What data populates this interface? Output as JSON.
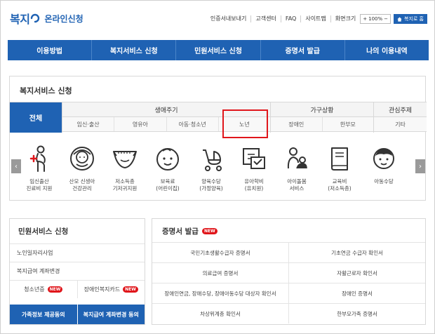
{
  "header": {
    "logo_text": "복지",
    "logo_sub": "온라인신청",
    "util_links": [
      "인증서내보내기",
      "고객센터",
      "FAQ",
      "사이트맵"
    ],
    "zoom_label": "화면크기",
    "zoom_plus": "+",
    "zoom_value": "100%",
    "zoom_minus": "−",
    "home_label": "복지로 홈"
  },
  "gnb": [
    "이용방법",
    "복지서비스 신청",
    "민원서비스 신청",
    "증명서 발급",
    "나의 이용내역"
  ],
  "welfare": {
    "title": "복지서비스 신청",
    "tab_all": "전체",
    "groups": [
      {
        "head": "생애주기",
        "subs": [
          "임신·출산",
          "영유아",
          "아동·청소년",
          "노년"
        ]
      },
      {
        "head": "가구상황",
        "subs": [
          "장애인",
          "한부모"
        ]
      },
      {
        "head": "관심주제",
        "subs": [
          "기타"
        ]
      }
    ],
    "services": [
      {
        "icon": "pregnant-woman-icon",
        "line1": "임신출산",
        "line2": "진료비 지원"
      },
      {
        "icon": "newborn-baby-icon",
        "line1": "산모 신생아",
        "line2": "건강관리"
      },
      {
        "icon": "diaper-icon",
        "line1": "저소득층",
        "line2": "기저귀지원"
      },
      {
        "icon": "child-face-icon",
        "line1": "보육료",
        "line2": "(어린이집)"
      },
      {
        "icon": "stroller-icon",
        "line1": "양육수당",
        "line2": "(가정양육)"
      },
      {
        "icon": "kindergarten-icon",
        "line1": "유아학비",
        "line2": "(유치원)"
      },
      {
        "icon": "childcare-icon",
        "line1": "아이돌봄",
        "line2": "서비스"
      },
      {
        "icon": "book-icon",
        "line1": "교육비",
        "line2": "(저소득층)"
      },
      {
        "icon": "child-allowance-icon",
        "line1": "아동수당",
        "line2": ""
      }
    ]
  },
  "civil": {
    "title": "민원서비스 신청",
    "rows": [
      "노인일자리사업",
      "복지급여 계좌변경"
    ],
    "pair": [
      {
        "label": "청소년증",
        "badge": "NEW"
      },
      {
        "label": "장애인복지카드",
        "badge": "NEW"
      }
    ],
    "buttons": [
      "가족정보 제공동의",
      "복지급여 계좌변경 동의"
    ]
  },
  "cert": {
    "title": "증명서 발급",
    "badge": "NEW",
    "rows": [
      [
        "국민기초생활수급자 증명서",
        "기초연금 수급자 확인서"
      ],
      [
        "의료급여 증명서",
        "자활근로자 확인서"
      ],
      [
        "장애인연금, 장애수당, 장애아동수당 대상자 확인서",
        "장애인 증명서"
      ],
      [
        "차상위계층 확인서",
        "한부모가족 증명서"
      ]
    ]
  },
  "colors": {
    "brand": "#1f62b3",
    "highlight": "#e0161b",
    "new_badge": "#e0161b"
  }
}
